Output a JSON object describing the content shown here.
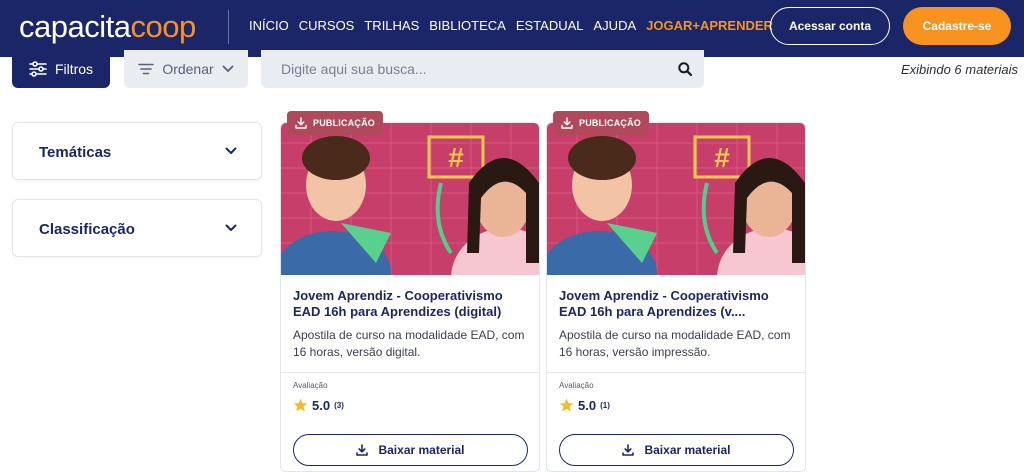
{
  "header": {
    "logo_part1": "capacita",
    "logo_part2": "coop",
    "nav": [
      {
        "label": "INÍCIO"
      },
      {
        "label": "CURSOS"
      },
      {
        "label": "TRILHAS"
      },
      {
        "label": "BIBLIOTECA"
      },
      {
        "label": "ESTADUAL"
      },
      {
        "label": "AJUDA"
      },
      {
        "label": "JOGAR+APRENDER"
      }
    ],
    "login_label": "Acessar conta",
    "signup_label": "Cadastre-se",
    "accent_color": "#f7931e",
    "brand_color": "#1b2668"
  },
  "toolbar": {
    "filters_label": "Filtros",
    "order_label": "Ordenar",
    "search_placeholder": "Digite aqui sua busca...",
    "result_count": "Exibindo 6 materiais"
  },
  "sidebar": {
    "items": [
      {
        "label": "Temáticas"
      },
      {
        "label": "Classificação"
      }
    ]
  },
  "cards": [
    {
      "badge": "PUBLICAÇÃO",
      "title": "Jovem Aprendiz - Cooperativismo EAD 16h para Aprendizes (digital)",
      "description": "Apostila de curso na modalidade EAD, com 16 horas, versão digital.",
      "rating_label": "Avaliação",
      "score": "5.0",
      "votes": "(3)",
      "download_label": "Baixar material"
    },
    {
      "badge": "PUBLICAÇÃO",
      "title": "Jovem Aprendiz - Cooperativismo EAD 16h para Aprendizes (v....",
      "description": "Apostila de curso na modalidade EAD, com 16 horas, versão impressão.",
      "rating_label": "Avaliação",
      "score": "5.0",
      "votes": "(1)",
      "download_label": "Baixar material"
    }
  ],
  "icons": {
    "filters": "sliders-icon",
    "order": "sort-lines-icon",
    "order_chevron": "chevron-down-icon",
    "search": "search-icon",
    "accordion": "chevron-down-icon",
    "badge": "download-icon",
    "star": "star-icon",
    "download": "download-icon"
  }
}
